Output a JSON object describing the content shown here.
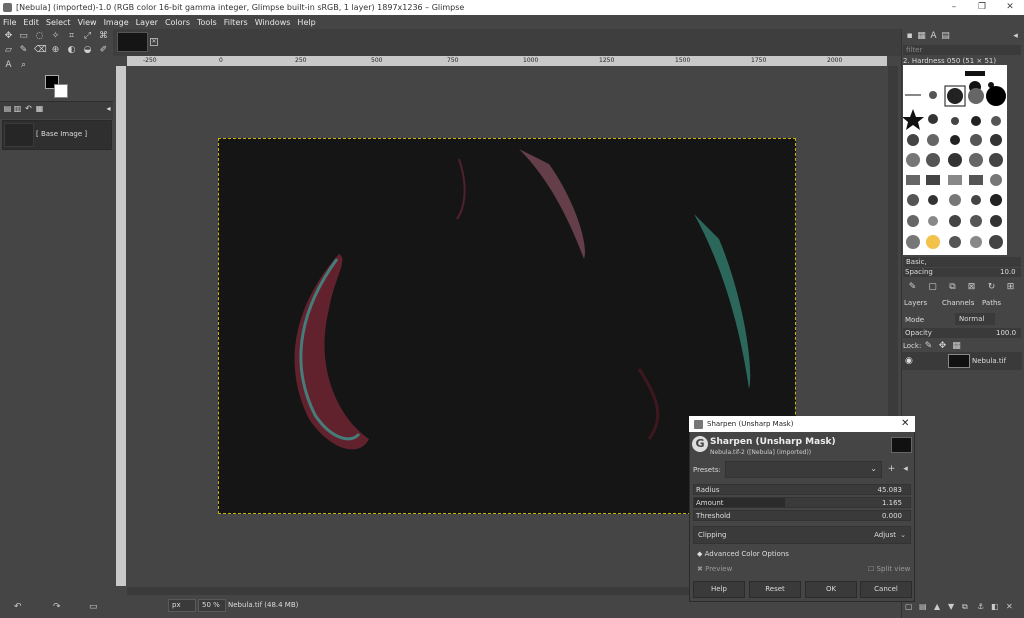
{
  "window": {
    "title": "[Nebula] (imported)-1.0 (RGB color 16-bit gamma integer, Glimpse built-in sRGB, 1 layer) 1897x1236 – Glimpse",
    "minimize": "–",
    "maximize": "❐",
    "close": "✕"
  },
  "menu": [
    "File",
    "Edit",
    "Select",
    "View",
    "Image",
    "Layer",
    "Colors",
    "Tools",
    "Filters",
    "Windows",
    "Help"
  ],
  "images_panel": {
    "item_label": "[ Base Image ]"
  },
  "ruler": {
    "ticks": [
      "-250",
      "0",
      "250",
      "500",
      "750",
      "1000",
      "1250",
      "1500",
      "1750",
      "2000"
    ]
  },
  "statusbar": {
    "unit": "px",
    "zoom": "50 %",
    "info": "Nebula.tif (48.4 MB)"
  },
  "brushes": {
    "filter_placeholder": "filter",
    "current": "2. Hardness 050 (51 × 51)",
    "set": "Basic,",
    "spacing_label": "Spacing",
    "spacing_value": "10.0"
  },
  "layers": {
    "tabs": [
      "Layers",
      "Channels",
      "Paths"
    ],
    "mode_label": "Mode",
    "mode_value": "Normal",
    "opacity_label": "Opacity",
    "opacity_value": "100.0",
    "lock_label": "Lock:",
    "layer_name": "Nebula.tif"
  },
  "dialog": {
    "window_title": "Sharpen (Unsharp Mask)",
    "heading": "Sharpen (Unsharp Mask)",
    "subtitle": "Nebula.tif-2 ([Nebula] (imported))",
    "presets_label": "Presets:",
    "radius_label": "Radius",
    "radius_value": "45.083",
    "amount_label": "Amount",
    "amount_value": "1.165",
    "amount_fraction": 0.42,
    "threshold_label": "Threshold",
    "threshold_value": "0.000",
    "clipping_label": "Clipping",
    "clipping_value": "Adjust",
    "advanced_label": "Advanced Color Options",
    "preview_label": "Preview",
    "split_label": "Split view",
    "buttons": {
      "help": "Help",
      "reset": "Reset",
      "ok": "OK",
      "cancel": "Cancel"
    }
  }
}
